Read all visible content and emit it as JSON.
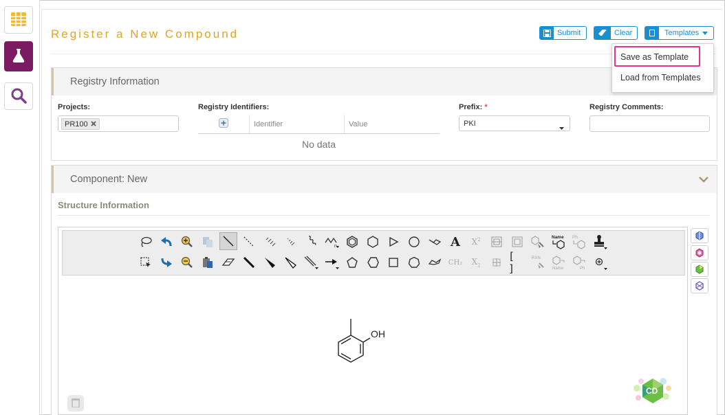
{
  "page": {
    "title": "Register a New Compound"
  },
  "nav": {
    "items": [
      {
        "icon": "table-icon",
        "active": false
      },
      {
        "icon": "flask-icon",
        "active": true
      },
      {
        "icon": "search-icon",
        "active": false
      }
    ]
  },
  "header_buttons": {
    "submit": "Submit",
    "clear": "Clear",
    "templates": "Templates"
  },
  "templates_menu": {
    "items": [
      "Save as Template",
      "Load from Templates"
    ],
    "highlighted": "Save as Template"
  },
  "registry": {
    "title": "Registry Information",
    "projects_label": "Projects:",
    "projects_tags": [
      "PR100"
    ],
    "identifiers_label": "Registry Identifiers:",
    "identifier_col": "Identifier",
    "value_col": "Value",
    "no_data": "No data",
    "prefix_label": "Prefix:",
    "prefix_required": "*",
    "prefix_value": "PKI",
    "comments_label": "Registry Comments:"
  },
  "component": {
    "title": "Component: New",
    "structure_title": "Structure Information"
  },
  "structure": {
    "atom_label": "OH",
    "toolbar_text": {
      "name": "Name",
      "ph": "Ph",
      "rxn": "RXN",
      "ch2": "CH₂",
      "x_super": "X",
      "x_sub": "X",
      "bracket": "[ ]",
      "text_tool": "A",
      "logo": "CD"
    }
  },
  "colors": {
    "accent": "#e3a324",
    "primary": "#1a8fd0",
    "nav_active": "#7b1b63",
    "highlight": "#e6328c"
  }
}
